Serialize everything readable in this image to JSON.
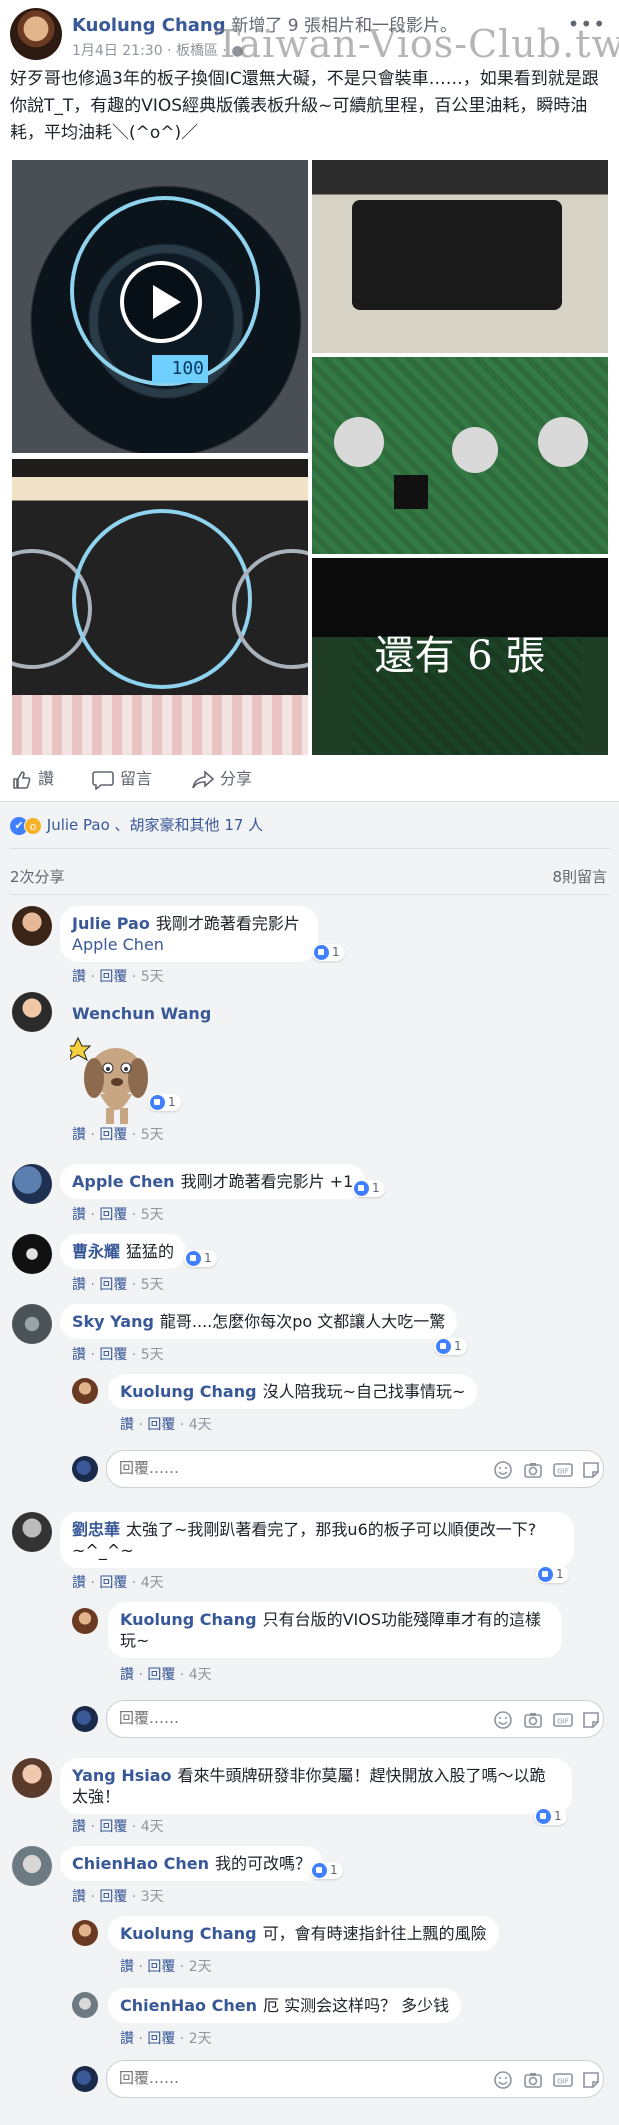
{
  "post": {
    "author": "Kuolung Chang",
    "action": "新增了 9 張相片和一段影片。",
    "date": "1月4日 21:30",
    "location": "板橋區",
    "watermark": "Taiwan-Vios-Club.tw",
    "text": "好歹哥也修過3年的板子換個IC還無大礙，不是只會裝車……，如果看到就是跟你說T_T，有趣的VIOS經典版儀表板升級~可續航里程，百公里油耗，瞬時油耗，平均油耗＼(^o^)／",
    "video_readout": "100",
    "more_photos": "還有 6 張"
  },
  "actions": {
    "like": "讚",
    "comment": "留言",
    "share": "分享"
  },
  "reactions": {
    "text": "Julie Pao 、胡家豪和其他 17 人"
  },
  "stats": {
    "shares": "2次分享",
    "comments": "8則留言"
  },
  "comment_meta": {
    "like": "讚",
    "reply": "回覆",
    "reply_placeholder": "回覆……"
  },
  "comments": [
    {
      "name": "Julie Pao",
      "text": "我剛才跪著看完影片",
      "tag": "Apple Chen",
      "likes": "1",
      "time": "5天"
    },
    {
      "name": "Wenchun Wang",
      "text": "",
      "likes": "1",
      "time": "5天"
    },
    {
      "name": "Apple Chen",
      "text": "我剛才跪著看完影片 +1",
      "likes": "1",
      "time": "5天"
    },
    {
      "name": "曹永耀",
      "text": "猛猛的",
      "likes": "1",
      "time": "5天"
    },
    {
      "name": "Sky Yang",
      "text": "龍哥....怎麼你每次po 文都讓人大吃一驚",
      "likes": "1",
      "time": "5天",
      "reply": {
        "name": "Kuolung Chang",
        "text": "沒人陪我玩~自己找事情玩~",
        "time": "4天"
      }
    },
    {
      "name": "劉忠華",
      "text": "太強了~我剛趴著看完了，那我u6的板子可以順便改一下?~^_^~",
      "likes": "1",
      "time": "4天",
      "reply": {
        "name": "Kuolung Chang",
        "text": "只有台版的VIOS功能殘障車才有的這樣玩~",
        "time": "4天"
      }
    },
    {
      "name": "Yang Hsiao",
      "text": "看來牛頭牌研發非你莫屬！趕快開放入股了嗎～以跪太強！",
      "likes": "1",
      "time": "4天"
    },
    {
      "name": "ChienHao Chen",
      "text": "我的可改嗎？",
      "likes": "1",
      "time": "3天",
      "replies": [
        {
          "name": "Kuolung Chang",
          "text": "可，會有時速指針往上飄的風險",
          "time": "2天"
        },
        {
          "name": "ChienHao Chen",
          "text": "厄 实测会这样吗？ 多少钱",
          "time": "2天"
        }
      ]
    }
  ],
  "colors": {
    "link": "#385898",
    "muted": "#90949c",
    "like_blue": "#4080ff",
    "panel": "#f2f3f5"
  }
}
